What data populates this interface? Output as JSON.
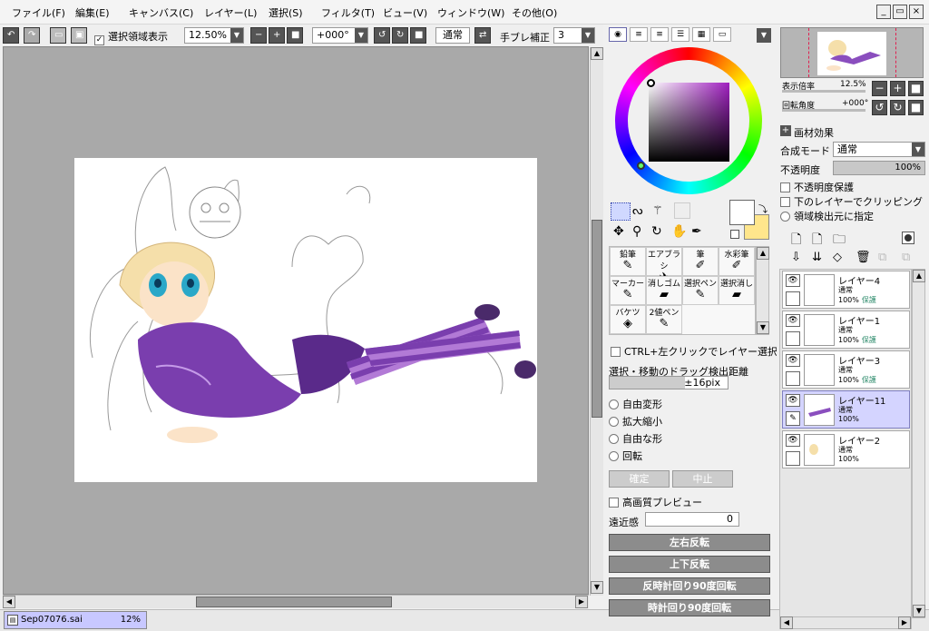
{
  "menu": [
    "ファイル(F)",
    "編集(E)",
    "キャンバス(C)",
    "レイヤー(L)",
    "選択(S)",
    "フィルタ(T)",
    "ビュー(V)",
    "ウィンドウ(W)",
    "その他(O)"
  ],
  "toolbar": {
    "show_selection_label": "選択領域表示",
    "show_selection_checked": true,
    "zoom": "12.50%",
    "rotation": "+000°",
    "blend": "通常",
    "stabilizer_label": "手ブレ補正",
    "stabilizer_value": "3"
  },
  "document": {
    "name": "Sep07076.sai",
    "zoom": "12%"
  },
  "color": {
    "hue_accent": "#7a2a7a",
    "fg": "#ffffff",
    "bg": "#ffe68c"
  },
  "tools": [
    {
      "label": "鉛筆",
      "icon": "pencil-icon",
      "glyph": "✎"
    },
    {
      "label": "エアブラシ",
      "icon": "airbrush-icon",
      "glyph": "✈"
    },
    {
      "label": "筆",
      "icon": "brush-icon",
      "glyph": "✐"
    },
    {
      "label": "水彩筆",
      "icon": "watercolor-icon",
      "glyph": "✐"
    },
    {
      "label": "マーカー",
      "icon": "marker-icon",
      "glyph": "✎"
    },
    {
      "label": "消しゴム",
      "icon": "eraser-icon",
      "glyph": "▰"
    },
    {
      "label": "選択ペン",
      "icon": "select-pen-icon",
      "glyph": "✎"
    },
    {
      "label": "選択消し",
      "icon": "select-erase-icon",
      "glyph": "▰"
    },
    {
      "label": "バケツ",
      "icon": "bucket-icon",
      "glyph": "◈"
    },
    {
      "label": "2値ペン",
      "icon": "binary-pen-icon",
      "glyph": "✎"
    }
  ],
  "options": {
    "ctrl_click_label": "CTRL+左クリックでレイヤー選択",
    "drag_distance_label": "選択・移動のドラッグ検出距離",
    "drag_distance_value": "±16pix",
    "transform_options": [
      "自由変形",
      "拡大縮小",
      "自由な形",
      "回転"
    ],
    "confirm_label": "確定",
    "cancel_label": "中止",
    "hq_preview_label": "高画質プレビュー",
    "perspective_label": "遠近感",
    "perspective_value": "0",
    "flip_h": "左右反転",
    "flip_v": "上下反転",
    "rotate_ccw": "反時計回り90度回転",
    "rotate_cw": "時計回り90度回転"
  },
  "navigator": {
    "zoom_label": "表示倍率",
    "zoom_value": "12.5%",
    "angle_label": "回転角度",
    "angle_value": "+000°"
  },
  "layer_props": {
    "effect_label": "画材効果",
    "blend_label": "合成モード",
    "blend_value": "通常",
    "opacity_label": "不透明度",
    "opacity_value": "100%",
    "protect_opacity": "不透明度保護",
    "clip_lower": "下のレイヤーでクリッピング",
    "selection_source": "領域検出元に指定"
  },
  "layers": [
    {
      "name": "レイヤー4",
      "mode": "通常",
      "opacity": "100%",
      "protect": "保護",
      "selected": false
    },
    {
      "name": "レイヤー1",
      "mode": "通常",
      "opacity": "100%",
      "protect": "保護",
      "selected": false
    },
    {
      "name": "レイヤー3",
      "mode": "通常",
      "opacity": "100%",
      "protect": "保護",
      "selected": false
    },
    {
      "name": "レイヤー11",
      "mode": "通常",
      "opacity": "100%",
      "protect": "",
      "selected": true
    },
    {
      "name": "レイヤー2",
      "mode": "通常",
      "opacity": "100%",
      "protect": "",
      "selected": false
    }
  ]
}
